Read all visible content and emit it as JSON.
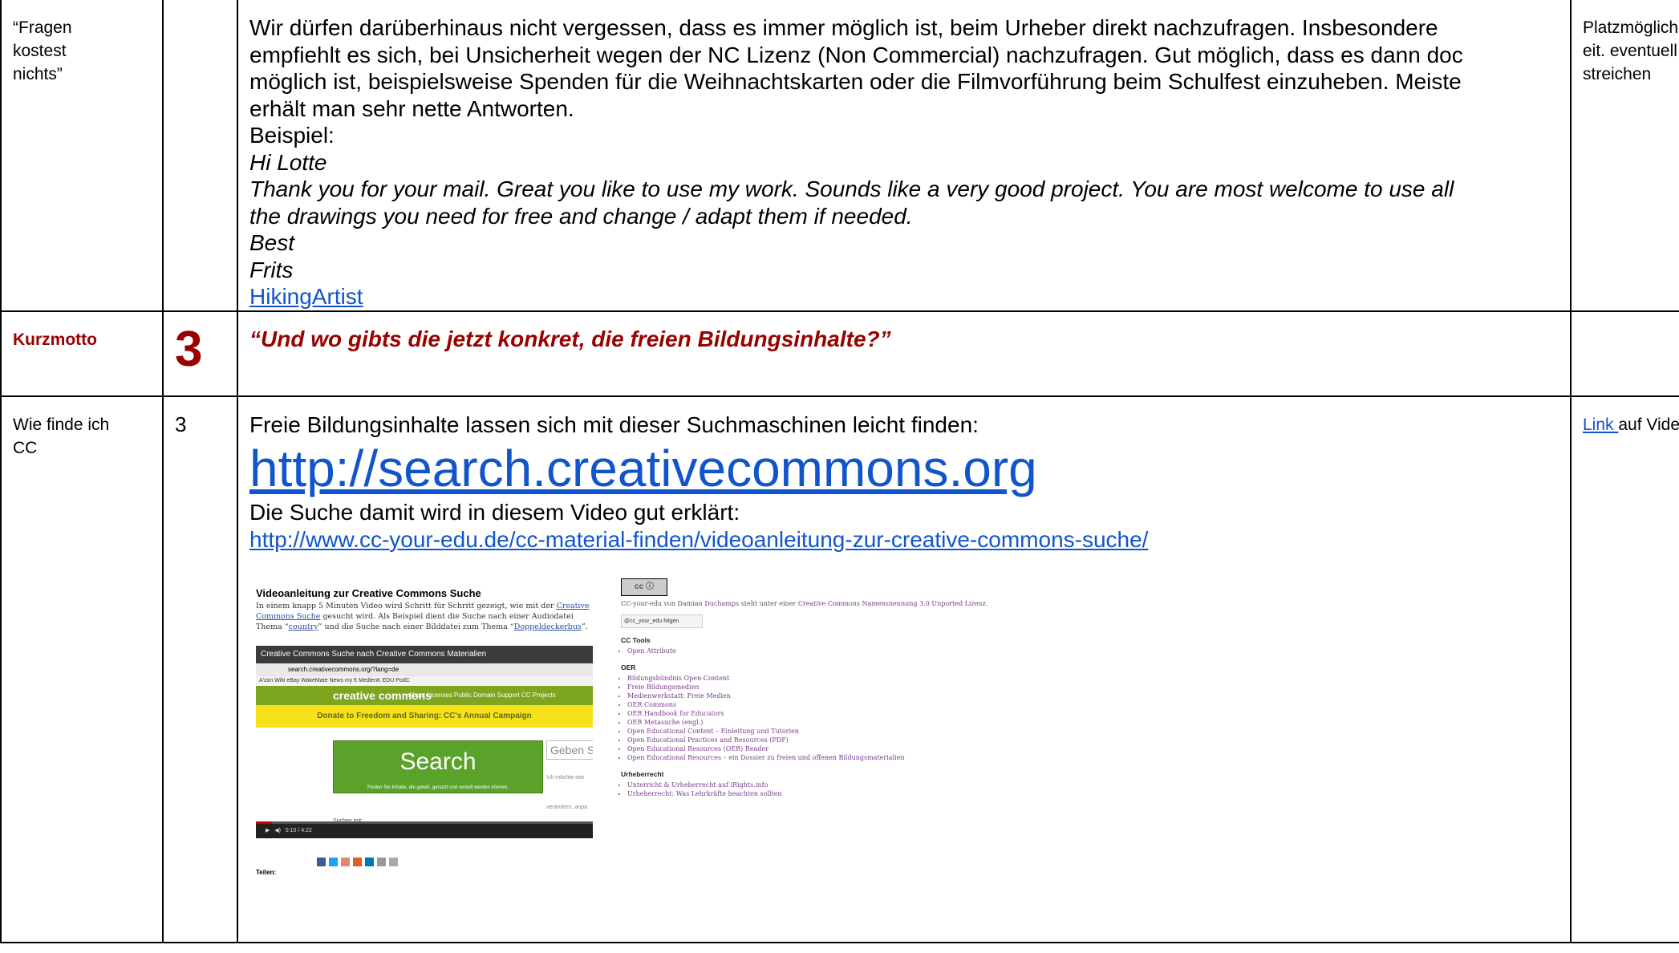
{
  "row1": {
    "col1": [
      "“Fragen",
      "kostest",
      "nichts”"
    ],
    "col3": {
      "para": [
        "Wir dürfen darüberhinaus nicht vergessen, dass es immer möglich ist, beim Urheber direkt nachzufragen. Insbesondere",
        "empfiehlt es sich, bei Unsicherheit wegen der NC Lizenz (Non Commercial) nachzufragen. Gut möglich, dass es dann doc",
        "möglich ist, beispielsweise Spenden für die Weihnachtskarten oder die Filmvorführung beim Schulfest einzuheben. Meiste",
        "erhält man sehr nette Antworten."
      ],
      "example_label": "Beispiel:",
      "example": [
        "Hi Lotte",
        "Thank you for your mail. Great you like to use my work. Sounds like a very good project. You are most welcome to use all",
        "the drawings you need for free and change / adapt them if needed.",
        "Best",
        "Frits"
      ],
      "link": "HikingArtist"
    },
    "col4": [
      "Platzmöglichk",
      "eit. eventuell",
      "streichen"
    ]
  },
  "row2": {
    "col1": "Kurzmotto",
    "col2": "3",
    "col3": "“Und wo gibts die jetzt konkret, die freien Bildungsinhalte?”"
  },
  "row3": {
    "col1": [
      "Wie finde ich",
      "CC"
    ],
    "col2": "3",
    "col3": {
      "line1": "Freie Bildungsinhalte lassen sich mit dieser Suchmaschinen leicht finden:",
      "big_link": "http://search.creativecommons.org",
      "line2": "Die Suche damit wird in diesem Video gut erklärt:",
      "video_link": "http://www.cc-your-edu.de/cc-material-finden/videoanleitung-zur-creative-commons-suche/",
      "embed": {
        "heading": "Videoanleitung zur Creative Commons Suche",
        "para_a": "In einem knapp 5 Minuten Video wird Schritt für Schritt gezeigt, wie mit der ",
        "para_link1": "Creative Commons Suche",
        "para_b": " gesucht wird. Als Beispiel dient die Suche nach einer Audiodatei Thema “",
        "para_link2": "country",
        "para_c": "” und die Suche nach einer Bilddatei zum Thema “",
        "para_link3": "Doppeldeckerbus",
        "para_d": "”.",
        "video_title": "Creative Commons Suche nach Creative Commons Materialien",
        "video_url": "search.creativecommons.org/?lang=de",
        "bookmarks": "A'zon   Wiki   eBay   WakeMate   News   my   €   MedienK   EDU   PodC",
        "nav_brand": "creative commons",
        "nav_menu": "About    Licenses    Public Domain    Support CC    Projects",
        "banner": "Donate to Freedom and Sharing: CC's Annual Campaign",
        "search_btn": "Search",
        "search_sub": "Finden Sie Inhalte, die geteilt, genutzt und verteilt werden können.",
        "side_box": "Geben S",
        "side_text1": "Ich möchte etw",
        "side_text2": "verändern, anpa",
        "search_with": "Suchen mit:",
        "video_time": "0:10 / 4:22",
        "share_label": "Teilen:",
        "sidebar": {
          "license_badge": "cc ⓘ",
          "license_text_a": "CC-your-edu von ",
          "license_author": "Damian Duchamps",
          "license_text_b": " steht unter einer ",
          "license_link": "Creative Commons Namensnennung 3.0 Unported Lizenz.",
          "twitter": "@cc_your_edu folgen",
          "h_tools": "CC Tools",
          "tools": [
            "Open Attribute"
          ],
          "h_oer": "OER",
          "oer": [
            "Bildungsbündnis Open-Content",
            "Freie Bildungsmedien",
            "Medienwerkstatt: Freie Medien",
            "OER Commons",
            "OER Handbook for Educators",
            "OER Metasuche (engl.)",
            "Open Educational Content – Einleitung und Tutorien",
            "Open Educational Practices and Resources (PDF)",
            "Open Educational Resources (OER) Reader",
            "Open Educational Resources – ein Dossier zu freien und offenen Bildungsmaterialien"
          ],
          "h_urh": "Urheberrecht",
          "urh": [
            "Unterricht & Urheberrecht auf iRights.info",
            "Urheberrecht: Was Lehrkräfte beachten sollten"
          ]
        }
      }
    },
    "col4_link": "Link ",
    "col4_rest": "auf Video"
  },
  "colors": {
    "accent_red": "#990000",
    "link_blue": "#1155cc"
  }
}
